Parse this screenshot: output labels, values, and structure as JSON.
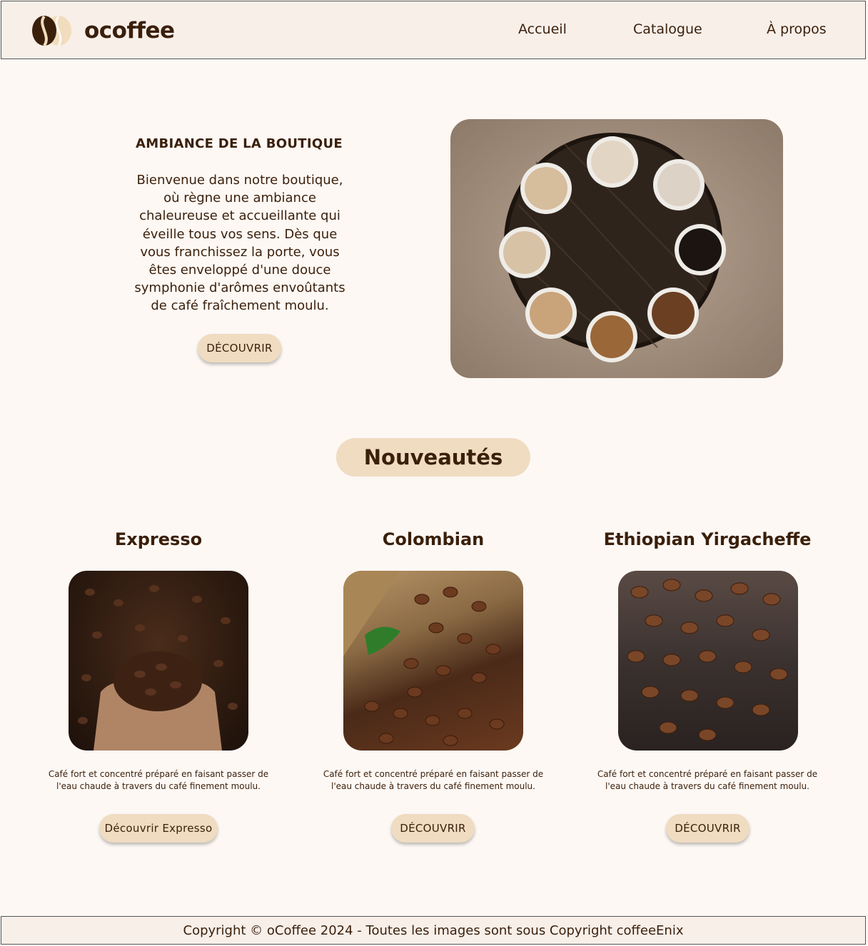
{
  "header": {
    "brand": "ocoffee",
    "nav": [
      {
        "label": "Accueil"
      },
      {
        "label": "Catalogue"
      },
      {
        "label": "À propos"
      }
    ]
  },
  "hero": {
    "title": "AMBIANCE DE LA BOUTIQUE",
    "text": "Bienvenue dans notre boutique, où règne une ambiance chaleureuse et accueillante qui éveille tous vos sens. Dès que vous franchissez la porte, vous êtes enveloppé d'une douce symphonie d'arômes envoûtants de café fraîchement moulu.",
    "button": "DÉCOUVRIR"
  },
  "section": {
    "title": "Nouveautés"
  },
  "products": [
    {
      "name": "Expresso",
      "description": "Café fort et concentré préparé en faisant passer de l'eau chaude à travers du café finement moulu.",
      "button": "Découvrir Expresso"
    },
    {
      "name": "Colombian",
      "description": "Café fort et concentré préparé en faisant passer de l'eau chaude à travers du café finement moulu.",
      "button": "DÉCOUVRIR"
    },
    {
      "name": "Ethiopian Yirgacheffe",
      "description": "Café fort et concentré préparé en faisant passer de l'eau chaude à travers du café finement moulu.",
      "button": "DÉCOUVRIR"
    }
  ],
  "footer": {
    "text": "Copyright © oCoffee 2024 - Toutes les images sont sous Copyright coffeeEnix"
  },
  "colors": {
    "background": "#fdf8f4",
    "header_bg": "#f8efe9",
    "accent": "#efdcc1",
    "text": "#3a1f0a"
  }
}
